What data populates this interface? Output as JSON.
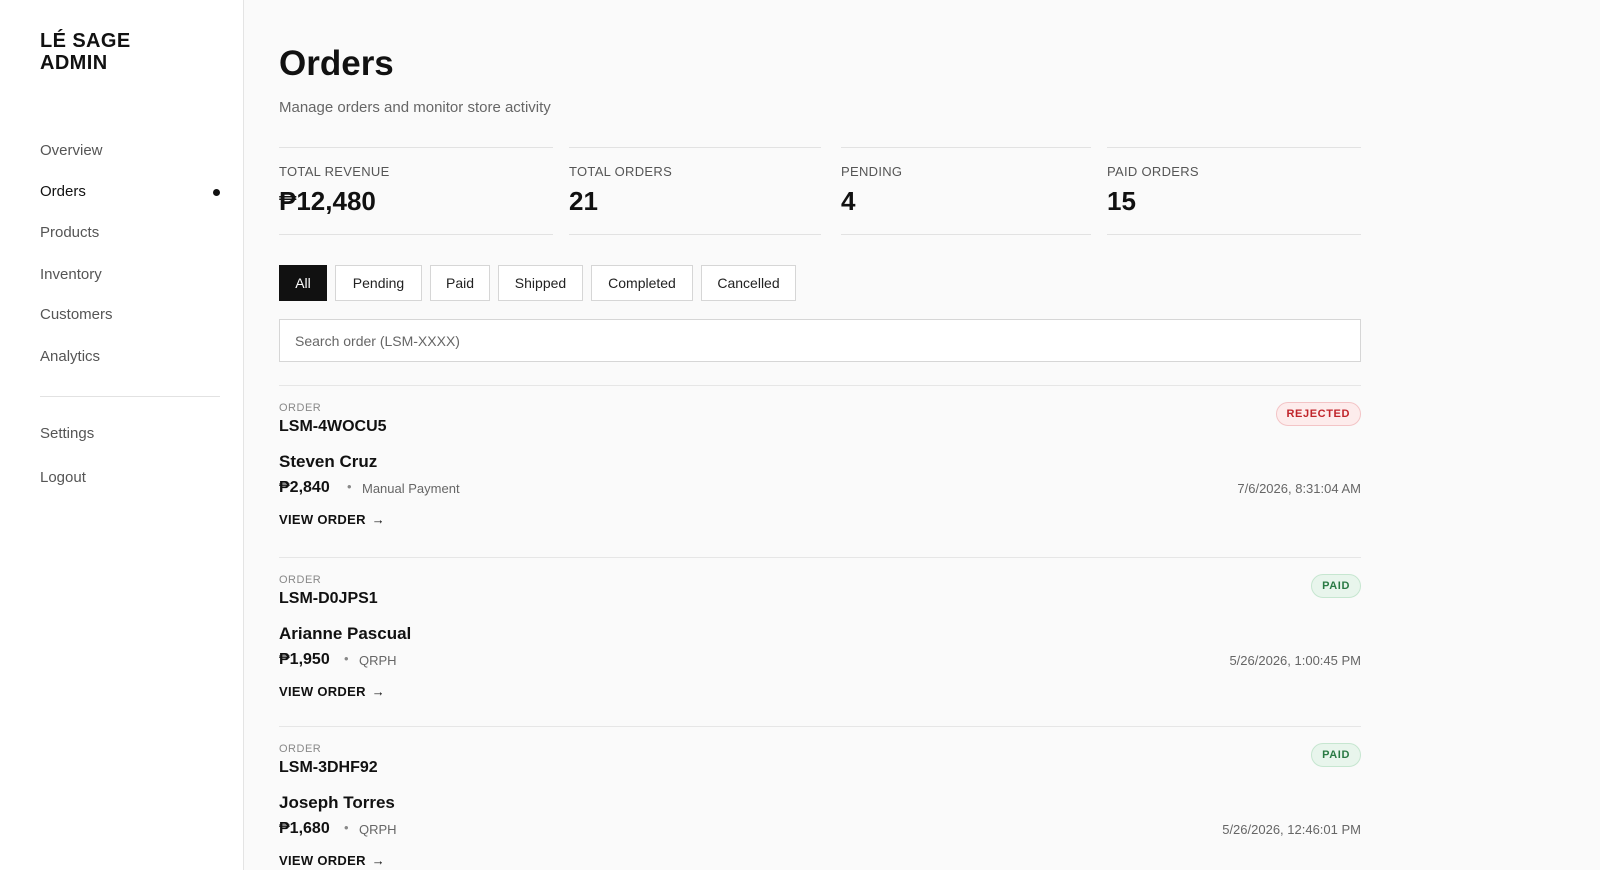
{
  "sidebar": {
    "brand_line1": "LÉ SAGE",
    "brand_line2": "ADMIN",
    "nav": [
      {
        "label": "Overview",
        "active": false
      },
      {
        "label": "Orders",
        "active": true
      },
      {
        "label": "Products",
        "active": false
      },
      {
        "label": "Inventory",
        "active": false
      },
      {
        "label": "Customers",
        "active": false
      },
      {
        "label": "Analytics",
        "active": false
      }
    ],
    "settings": "Settings",
    "logout": "Logout"
  },
  "header": {
    "title": "Orders",
    "subtitle": "Manage orders and monitor store activity"
  },
  "stats": [
    {
      "label": "TOTAL REVENUE",
      "value": "₱12,480"
    },
    {
      "label": "TOTAL ORDERS",
      "value": "21"
    },
    {
      "label": "PENDING",
      "value": "4"
    },
    {
      "label": "PAID ORDERS",
      "value": "15"
    }
  ],
  "filters": {
    "tabs": [
      "All",
      "Pending",
      "Paid",
      "Shipped",
      "Completed",
      "Cancelled"
    ],
    "active": "All"
  },
  "search": {
    "placeholder": "Search order (LSM-XXXX)",
    "value": ""
  },
  "orders": [
    {
      "kicker": "ORDER",
      "id": "LSM-4WOCU5",
      "status": "REJECTED",
      "customer": "Steven Cruz",
      "amount": "₱2,840",
      "separator": "•",
      "method": "Manual Payment",
      "date": "7/6/2026, 8:31:04 AM",
      "link": "VIEW ORDER",
      "link_arrow": "→"
    },
    {
      "kicker": "ORDER",
      "id": "LSM-D0JPS1",
      "status": "PAID",
      "customer": "Arianne Pascual",
      "amount": "₱1,950",
      "separator": "•",
      "method": "QRPH",
      "date": "5/26/2026, 1:00:45 PM",
      "link": "VIEW ORDER",
      "link_arrow": "→"
    },
    {
      "kicker": "ORDER",
      "id": "LSM-3DHF92",
      "status": "PAID",
      "customer": "Joseph Torres",
      "amount": "₱1,680",
      "separator": "•",
      "method": "QRPH",
      "date": "5/26/2026, 12:46:01 PM",
      "link": "VIEW ORDER",
      "link_arrow": "→"
    }
  ],
  "colors": {
    "accent": "#111111",
    "rejected_text": "#c0242a",
    "rejected_bg": "#fdecec",
    "paid_text": "#2a7a44",
    "paid_bg": "#e8f5ec"
  }
}
